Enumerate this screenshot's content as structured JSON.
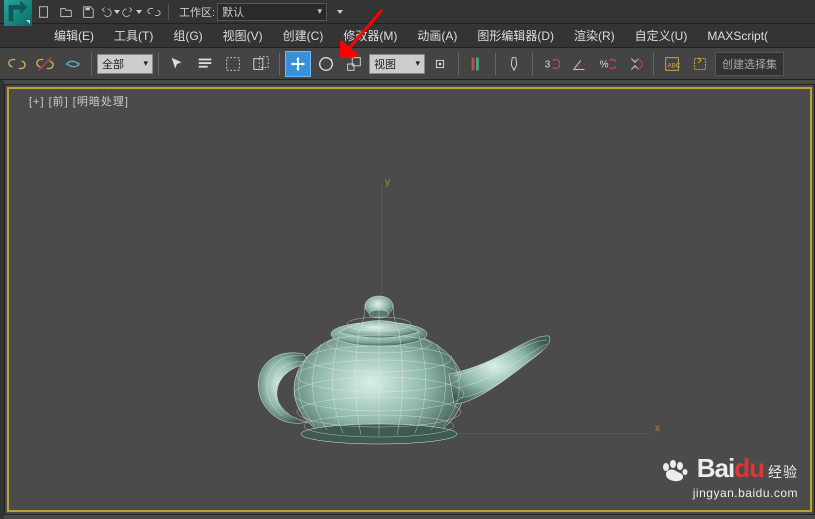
{
  "qa": {
    "workspace_label": "工作区:",
    "workspace_value": "默认"
  },
  "menu": {
    "items": [
      "编辑(E)",
      "工具(T)",
      "组(G)",
      "视图(V)",
      "创建(C)",
      "修改器(M)",
      "动画(A)",
      "图形编辑器(D)",
      "渲染(R)",
      "自定义(U)",
      "MAXScript("
    ]
  },
  "toolbar": {
    "filter_value": "全部",
    "view_value": "视图",
    "create_set_label": "创建选择集"
  },
  "viewport": {
    "label": "[+] [前] [明暗处理]",
    "axis_x": "x",
    "axis_y": "y"
  },
  "watermark": {
    "brand1": "Bai",
    "brand2": "du",
    "sub": "经验",
    "url": "jingyan.baidu.com"
  }
}
